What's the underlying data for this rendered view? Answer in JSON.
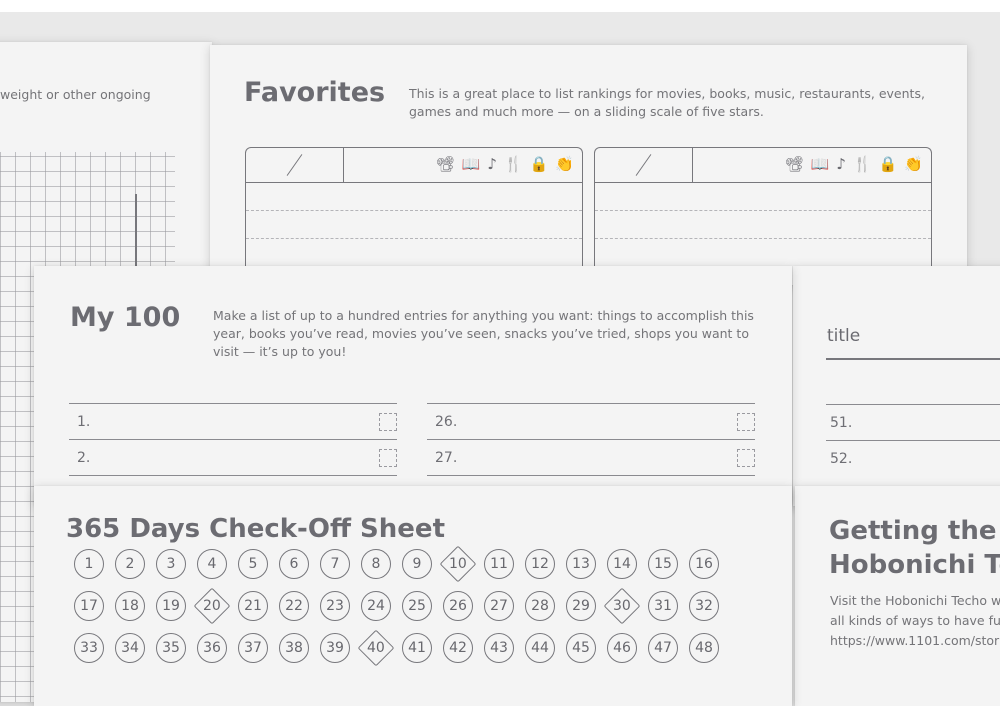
{
  "left_page": {
    "text": "weight or other ongoing"
  },
  "favorites": {
    "title": "Favorites",
    "description": "This is a great place to list rankings for movies, books, music, restaurants, events, games and much more — on a sliding scale of five stars.",
    "icons": [
      "movie-camera-icon",
      "book-icon",
      "music-note-icon",
      "fork-knife-icon",
      "bag-icon",
      "clapping-hands-icon"
    ],
    "icon_glyphs": [
      "📽",
      "📖",
      "♪",
      "🍴",
      "🔒",
      "👏"
    ]
  },
  "my100": {
    "title": "My 100",
    "description": "Make a list of up to a hundred entries for anything you want: things to accomplish this year, books you’ve read, movies you’ve seen, snacks you’ve tried, shops you want to visit — it’s up to you!",
    "col1": [
      "1.",
      "2."
    ],
    "col2": [
      "26.",
      "27."
    ],
    "col3": [
      "51.",
      "52."
    ]
  },
  "title_page": {
    "title": "title"
  },
  "days365": {
    "title": "365 Days Check-Off Sheet",
    "rows": [
      [
        "1",
        "2",
        "3",
        "4",
        "5",
        "6",
        "7",
        "8",
        "9",
        "10",
        "11",
        "12",
        "13",
        "14",
        "15",
        "16"
      ],
      [
        "17",
        "18",
        "19",
        "20",
        "21",
        "22",
        "23",
        "24",
        "25",
        "26",
        "27",
        "28",
        "29",
        "30",
        "31",
        "32"
      ],
      [
        "33",
        "34",
        "35",
        "36",
        "37",
        "38",
        "39",
        "40",
        "41",
        "42",
        "43",
        "44",
        "45",
        "46",
        "47",
        "48"
      ]
    ],
    "diamonds": [
      "10",
      "20",
      "30",
      "40"
    ]
  },
  "getting": {
    "title_line1": "Getting the M",
    "title_line2": "Hobonichi Te",
    "text_line1": "Visit the Hobonichi Techo w",
    "text_line2": "all kinds of ways to have fun",
    "text_line3": "https://www.1101.com/stor"
  }
}
